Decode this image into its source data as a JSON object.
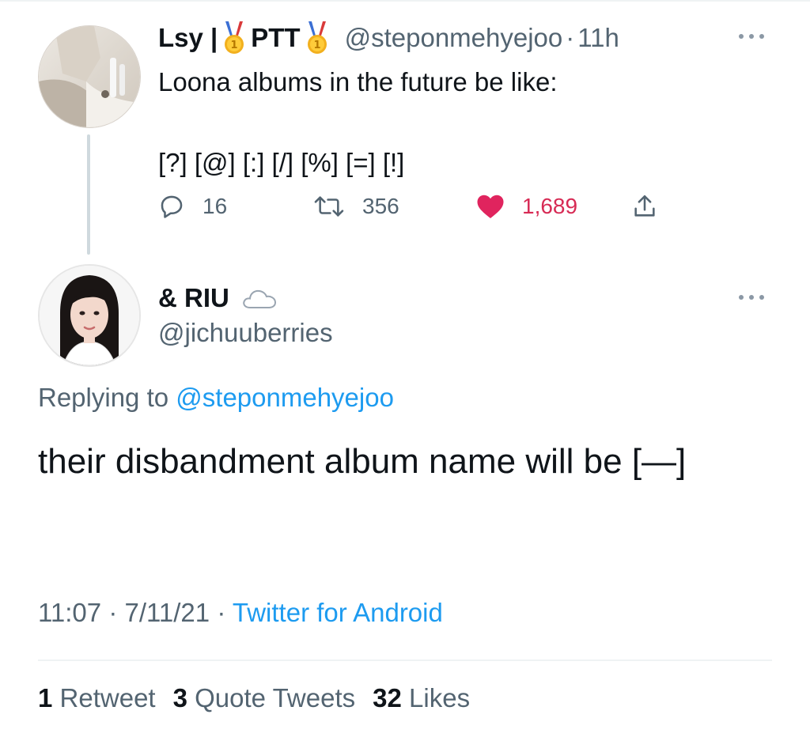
{
  "parent_tweet": {
    "display_name_1": "Lsy |",
    "display_name_2": "PTT",
    "badge_icon": "medal-icon",
    "handle": "@steponmehyejoo",
    "separator": "·",
    "time": "11h",
    "text_line_1": "Loona albums in the future be like:",
    "text_line_2": "[?] [@] [:] [/] [%] [=] [!]",
    "reply_count": "16",
    "retweet_count": "356",
    "like_count": "1,689",
    "liked": true
  },
  "reply_tweet": {
    "display_name": "& RIU",
    "badge_icon": "cloud-icon",
    "handle": "@jichuuberries",
    "replying_prefix": "Replying to",
    "replying_to": "@steponmehyejoo",
    "text": "their disbandment album name will be [—]",
    "time": "11:07",
    "separator": "·",
    "date": "7/11/21",
    "source": "Twitter for Android"
  },
  "stats": {
    "retweets_count": "1",
    "retweets_label": "Retweet",
    "quotes_count": "3",
    "quotes_label": "Quote Tweets",
    "likes_count": "32",
    "likes_label": "Likes"
  },
  "colors": {
    "text": "#0f1419",
    "secondary": "#536471",
    "link": "#1d9bf0",
    "like": "#d72b55",
    "divider": "#eff3f4"
  }
}
